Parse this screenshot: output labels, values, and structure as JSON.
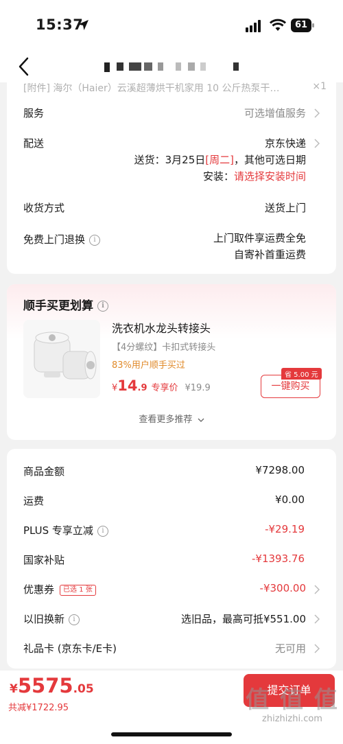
{
  "status_bar": {
    "time": "15:37",
    "battery": "61"
  },
  "nav": {
    "back_icon": "chevron-left-icon"
  },
  "order_info": {
    "attachment_text": "[附件] 海尔（Haier）云溪超薄烘干机家用 10 公斤热泵干…",
    "attachment_qty": "×1",
    "service_label": "服务",
    "service_value": "可选增值服务",
    "delivery_label": "配送",
    "delivery_value": "京东快递",
    "delivery_date_prefix": "送货：3月25日",
    "delivery_weekday": "[周二]",
    "delivery_date_suffix": "，其他可选日期",
    "install_prefix": "安装：",
    "install_value": "请选择安装时间",
    "receive_label": "收货方式",
    "receive_value": "送货上门",
    "return_label": "免费上门退换",
    "return_line1": "上门取件享运费全免",
    "return_line2": "自寄补首重运费"
  },
  "recommend": {
    "title": "顺手买更划算",
    "product_name": "洗衣机水龙头转接头",
    "product_spec": "【4分螺纹】卡扣式转接头",
    "popularity": "83%用户顺手买过",
    "price_symbol": "¥",
    "price_int": "14",
    "price_dec": ".9",
    "price_tag": "专享价",
    "original_price": "¥19.9",
    "save_tag": "省 5.00 元",
    "buy_button": "一键购买",
    "more_label": "查看更多推荐"
  },
  "summary": {
    "rows": [
      {
        "label": "商品金额",
        "value": "¥7298.00"
      },
      {
        "label": "运费",
        "value": "¥0.00"
      },
      {
        "label": "PLUS 专享立减",
        "value": "-¥29.19"
      },
      {
        "label": "国家补贴",
        "value": "-¥1393.76"
      },
      {
        "label": "优惠券",
        "value": "-¥300.00",
        "badge": "已选 1 张"
      },
      {
        "label": "以旧换新",
        "value": "选旧品，最高可抵¥551.00"
      },
      {
        "label": "礼品卡 (京东卡/E卡)",
        "value": "无可用"
      }
    ]
  },
  "bottom": {
    "price_symbol": "¥",
    "price_int": "5575",
    "price_dec": ".05",
    "total_saved": "共减¥1722.95",
    "submit_button": "提交订单",
    "watermark_big": "值 值 值",
    "watermark_small": "zhizhizhi.com"
  },
  "colors": {
    "accent": "#e4393c",
    "popularity": "#e08a2a"
  }
}
